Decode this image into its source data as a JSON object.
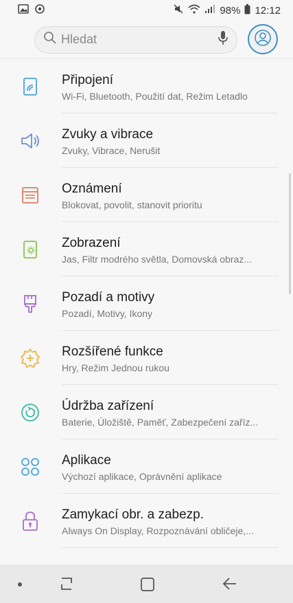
{
  "status_bar": {
    "battery": "98%",
    "time": "12:12",
    "icons": [
      "gallery-icon",
      "sync-icon",
      "mute-icon",
      "wifi-icon",
      "signal-icon",
      "battery-icon"
    ]
  },
  "search": {
    "placeholder": "Hledat",
    "icons": [
      "search-icon",
      "mic-icon",
      "profile-icon"
    ]
  },
  "settings": [
    {
      "title": "Připojení",
      "subtitle": "Wi-Fi, Bluetooth, Použití dat, Režim Letadlo",
      "icon": "connections-icon",
      "color": "#4aa3df"
    },
    {
      "title": "Zvuky a vibrace",
      "subtitle": "Zvuky, Vibrace, Nerušit",
      "icon": "sound-icon",
      "color": "#6b8fd3"
    },
    {
      "title": "Oznámení",
      "subtitle": "Blokovat, povolit, stanovit prioritu",
      "icon": "notifications-icon",
      "color": "#e07b5f"
    },
    {
      "title": "Zobrazení",
      "subtitle": "Jas, Filtr modrého světla, Domovská obraz...",
      "icon": "display-icon",
      "color": "#8cc152"
    },
    {
      "title": "Pozadí a motivy",
      "subtitle": "Pozadí, Motivy, Ikony",
      "icon": "themes-icon",
      "color": "#a86ccf"
    },
    {
      "title": "Rozšířené funkce",
      "subtitle": "Hry, Režim Jednou rukou",
      "icon": "advanced-icon",
      "color": "#f0b342"
    },
    {
      "title": "Údržba zařízení",
      "subtitle": "Baterie, Úložiště, Paměť, Zabezpečení zaříz...",
      "icon": "maintenance-icon",
      "color": "#3cb9a0"
    },
    {
      "title": "Aplikace",
      "subtitle": "Výchozí aplikace, Oprávnění aplikace",
      "icon": "apps-icon",
      "color": "#4aa3df"
    },
    {
      "title": "Zamykací obr. a zabezp.",
      "subtitle": "Always On Display, Rozpoznávání obličeje,...",
      "icon": "lock-icon",
      "color": "#a86ccf"
    }
  ],
  "nav": {
    "icons": [
      "nav-dot-icon",
      "recent-apps-icon",
      "home-icon",
      "back-icon"
    ]
  }
}
